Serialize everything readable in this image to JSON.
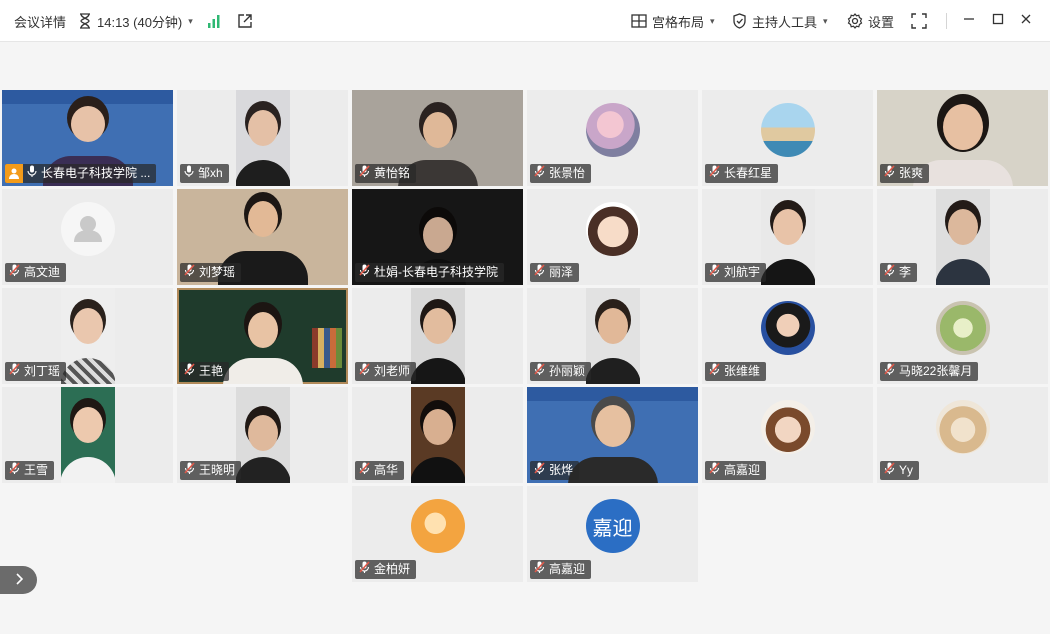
{
  "titlebar": {
    "meeting_details": "会议详情",
    "timer": "14:13 (40分钟)",
    "layout_label": "宫格布局",
    "host_tools_label": "主持人工具",
    "settings_label": "设置"
  },
  "colors": {
    "mic_muted": "#e0594a",
    "host_badge": "#f39b1a",
    "signal": "#2fb873"
  },
  "participants": [
    {
      "name": "长春电子科技学院 ...",
      "mic": "on",
      "host": true,
      "kind": "video-banner"
    },
    {
      "name": "邹xh",
      "mic": "on",
      "kind": "video-portrait"
    },
    {
      "name": "黄怡铭",
      "mic": "muted",
      "kind": "video-wide"
    },
    {
      "name": "张景怡",
      "mic": "muted",
      "kind": "avatar",
      "avatar_icon": "doll-avatar"
    },
    {
      "name": "长春红星",
      "mic": "muted",
      "kind": "avatar",
      "avatar_icon": "sea-rocks-avatar"
    },
    {
      "name": "张爽",
      "mic": "muted",
      "kind": "video-wide"
    },
    {
      "name": "高文迪",
      "mic": "muted",
      "kind": "default-avatar"
    },
    {
      "name": "刘梦瑶",
      "mic": "muted",
      "kind": "video-wide"
    },
    {
      "name": "杜娟-长春电子科技学院",
      "mic": "muted",
      "kind": "video-dark"
    },
    {
      "name": "丽泽",
      "mic": "muted",
      "kind": "avatar",
      "avatar_icon": "cartoon-girl-avatar"
    },
    {
      "name": "刘航宇",
      "mic": "muted",
      "kind": "video-portrait"
    },
    {
      "name": "李",
      "mic": "muted",
      "kind": "video-portrait"
    },
    {
      "name": "刘丁瑶",
      "mic": "muted",
      "kind": "video-portrait"
    },
    {
      "name": "王艳",
      "mic": "muted",
      "kind": "video-blackboard"
    },
    {
      "name": "刘老师",
      "mic": "muted",
      "kind": "video-portrait"
    },
    {
      "name": "孙丽颖",
      "mic": "muted",
      "kind": "video-portrait"
    },
    {
      "name": "张维维",
      "mic": "muted",
      "kind": "avatar",
      "avatar_icon": "woman-photo-avatar"
    },
    {
      "name": "马晓22张馨月",
      "mic": "muted",
      "kind": "avatar",
      "avatar_icon": "green-food-avatar"
    },
    {
      "name": "王雪",
      "mic": "muted",
      "kind": "video-portrait"
    },
    {
      "name": "王晓明",
      "mic": "muted",
      "kind": "video-portrait"
    },
    {
      "name": "高华",
      "mic": "muted",
      "kind": "video-portrait"
    },
    {
      "name": "张烨",
      "mic": "muted",
      "kind": "video-banner"
    },
    {
      "name": "高嘉迎",
      "mic": "muted",
      "kind": "avatar",
      "avatar_icon": "cartoon-boy-avatar"
    },
    {
      "name": "Yy",
      "mic": "muted",
      "kind": "avatar",
      "avatar_icon": "cat-avatar"
    },
    {
      "name": "金柏妍",
      "mic": "muted",
      "kind": "avatar",
      "avatar_icon": "orange-avatar"
    },
    {
      "name": "高嘉迎",
      "mic": "muted",
      "kind": "text-avatar",
      "avatar_text": "嘉迎"
    }
  ]
}
